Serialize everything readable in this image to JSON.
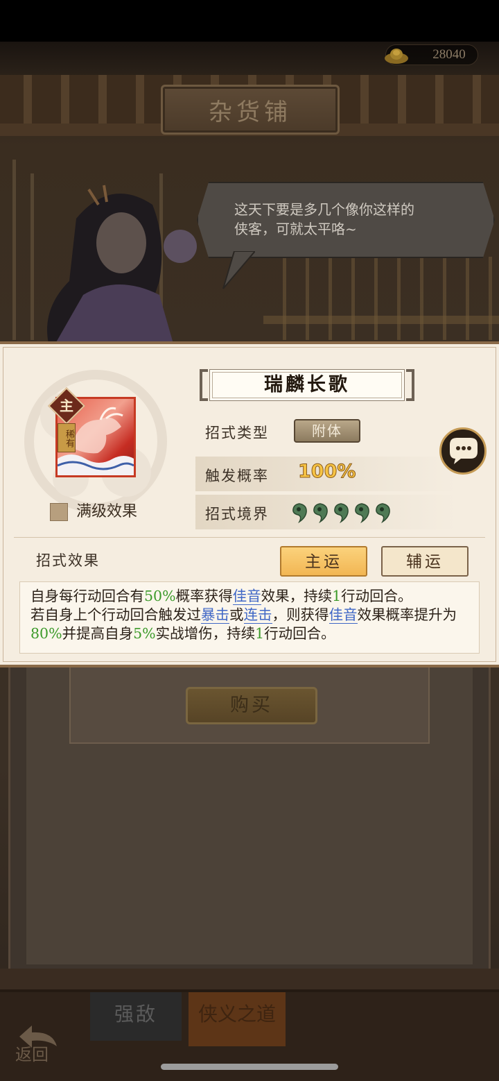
{
  "shop": {
    "title": "杂货铺",
    "currency_amount": "28040",
    "currency_icon": "gold-ingot-icon",
    "npc_quote_line1": "这天下要是多几个像你这样的",
    "npc_quote_line2": "侠客，可就太平咯~",
    "buy_label": "购买",
    "bottom_tabs": [
      "强敌",
      "侠义之道"
    ],
    "back_label": "返回"
  },
  "skill": {
    "name": "瑞麟长歌",
    "badge_main": "主",
    "badge_rarity": "稀有",
    "max_level_label": "满级效果",
    "type_label": "招式类型",
    "type_value": "附体",
    "chance_label": "触发概率",
    "chance_value": "100%",
    "realm_label": "招式境界",
    "realm_level": 5,
    "effect_label": "招式效果",
    "tab_main": "主运",
    "tab_aux": "辅运",
    "description": [
      {
        "t": "自身每行动回合有",
        "s": ""
      },
      {
        "t": "50%",
        "s": "g"
      },
      {
        "t": "概率获得",
        "s": ""
      },
      {
        "t": "佳音",
        "s": "b"
      },
      {
        "t": "效果，持续",
        "s": ""
      },
      {
        "t": "1",
        "s": "g"
      },
      {
        "t": "行动回合。",
        "s": ""
      },
      {
        "t": "\n",
        "s": "br"
      },
      {
        "t": "若自身上个行动回合触发过",
        "s": ""
      },
      {
        "t": "暴击",
        "s": "b"
      },
      {
        "t": "或",
        "s": ""
      },
      {
        "t": "连击",
        "s": "b"
      },
      {
        "t": "，则获得",
        "s": ""
      },
      {
        "t": "佳音",
        "s": "b"
      },
      {
        "t": "效果概率提升为",
        "s": ""
      },
      {
        "t": "80%",
        "s": "g"
      },
      {
        "t": "并提高自身",
        "s": ""
      },
      {
        "t": "5%",
        "s": "g"
      },
      {
        "t": "实战增伤，持续",
        "s": ""
      },
      {
        "t": "1",
        "s": "g"
      },
      {
        "t": "行动回合。",
        "s": ""
      }
    ]
  },
  "colors": {
    "highlight_green": "#3c9a2a",
    "keyword_blue": "#3f67c6",
    "chance_gold": "#f6c343",
    "tab_active": "#f2b653"
  }
}
